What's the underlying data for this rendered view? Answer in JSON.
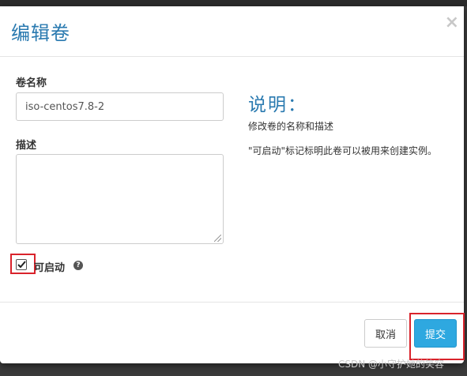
{
  "dialog": {
    "title": "编辑卷",
    "close_glyph": "×"
  },
  "form": {
    "name_label": "卷名称",
    "name_value": "iso-centos7.8-2",
    "description_label": "描述",
    "description_value": "",
    "bootable_label": "可启动",
    "bootable_checked": true,
    "help_glyph": "?"
  },
  "help": {
    "heading": "说明：",
    "line1": "修改卷的名称和描述",
    "line2": "\"可启动\"标记标明此卷可以被用来创建实例。"
  },
  "footer": {
    "cancel_label": "取消",
    "submit_label": "提交"
  },
  "watermark": "CSDN @小守护她的笑容",
  "colors": {
    "accent": "#2a7ab0",
    "submit": "#2ea8e0",
    "highlight": "#d9232b"
  }
}
